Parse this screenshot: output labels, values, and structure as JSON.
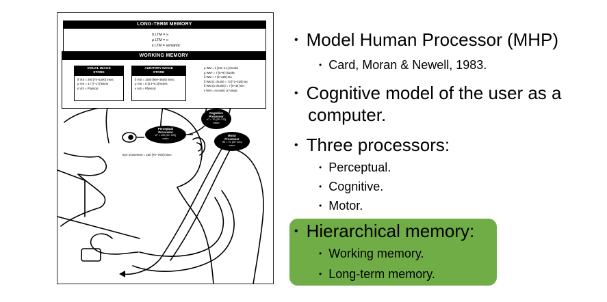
{
  "figure": {
    "ltm_title": "LONG-TERM MEMORY",
    "ltm_params": [
      "δ LTM = ∞",
      "μ LTM = ∞",
      "κ LTM = semantic"
    ],
    "wm_title": "WORKING MEMORY",
    "visual_store": {
      "title_1": "VISUAL IMAGE",
      "title_2": "STORE",
      "params": [
        "δ VIS = 200 [70~1000] msec",
        "μ VIS = 17 [7~17] letters",
        "κ VIS = Physical"
      ]
    },
    "auditory_store": {
      "title_1": "AUDITORY IMAGE",
      "title_2": "STORE",
      "params": [
        "δ AIS = 1500 [900~3500] msec",
        "μ AIS = 5 [4.4~6.2] letters",
        "κ AIS = Physical"
      ]
    },
    "wm_params": [
      "μ WM = 3 [2.5~4.1] chunks",
      "μ WM* = 7 [5~9] chunks",
      "δ WM = 7 [5~226] sec",
      "δ WM (1 chunk) = 73 [73~226] sec",
      "δ WM (3 chunks) = 7 [5~34] sec",
      "κ WM = Acoustic or Visual"
    ],
    "cognitive": {
      "l1": "Cognitive",
      "l2": "Processor",
      "p": "τC = 70 [25~170]",
      "u": "msec"
    },
    "perceptual": {
      "l1": "Perceptual",
      "l2": "Processor",
      "p": "τP = 100 [50~200]",
      "u": "msec"
    },
    "motor": {
      "l1": "Motor",
      "l2": "Processor",
      "p": "τM = 70 [30~100]",
      "u": "msec"
    },
    "eye_movement": "Eye movement = 230 [70~700] msec"
  },
  "bullets": {
    "b1": "Model Human Processor (MHP)",
    "b1_sub": "Card, Moran & Newell, 1983.",
    "b2_line1": "Cognitive model of the user as a",
    "b2_line2": "computer.",
    "b3": "Three processors:",
    "b3_sub": [
      "Perceptual.",
      "Cognitive.",
      "Motor."
    ],
    "b4": "Hierarchical memory:",
    "b4_sub": [
      "Working memory.",
      "Long-term memory."
    ]
  },
  "colors": {
    "highlight": "#70ad47",
    "text": "#000000"
  }
}
